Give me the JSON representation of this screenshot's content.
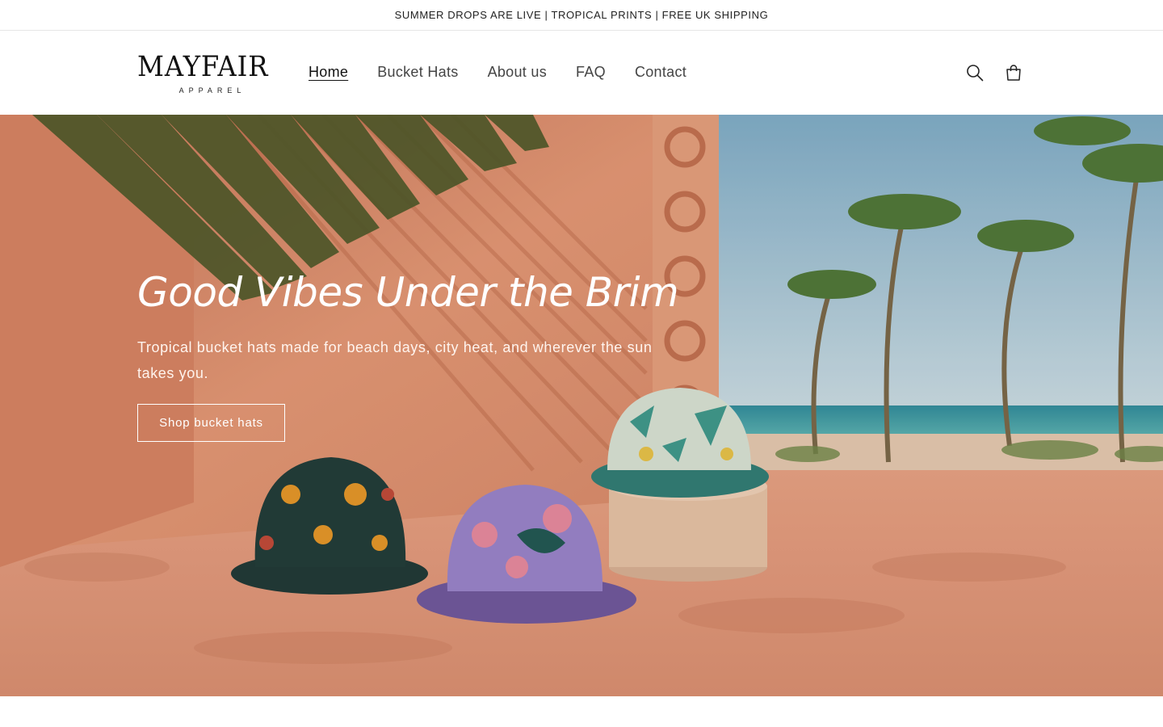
{
  "announcement": {
    "text": "SUMMER DROPS ARE LIVE | TROPICAL PRINTS | FREE UK SHIPPING"
  },
  "brand": {
    "name": "MAYFAIR",
    "tagline": "APPAREL"
  },
  "nav": {
    "items": [
      {
        "label": "Home",
        "active": true
      },
      {
        "label": "Bucket Hats",
        "active": false
      },
      {
        "label": "About us",
        "active": false
      },
      {
        "label": "FAQ",
        "active": false
      },
      {
        "label": "Contact",
        "active": false
      }
    ]
  },
  "header_icons": {
    "search": "search-icon",
    "cart": "cart-icon"
  },
  "hero": {
    "title": "Good Vibes Under the Brim",
    "subtitle": "Tropical bucket hats made for beach days, city heat, and wherever the sun takes you.",
    "cta_label": "Shop bucket hats"
  },
  "colors": {
    "hero_wall": "#e8a27f",
    "sky": "#9fc3d6",
    "sea": "#3aa0a8",
    "text_dark": "#121212",
    "white": "#ffffff"
  }
}
